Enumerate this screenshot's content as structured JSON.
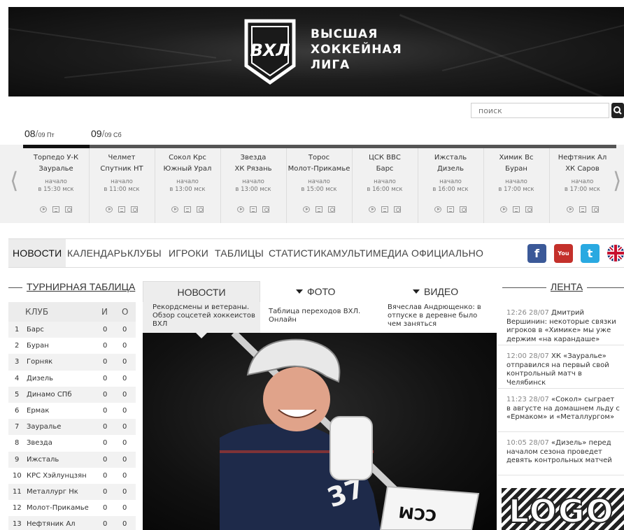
{
  "header": {
    "logo_mark": "ВХЛ",
    "logo_line1": "ВЫСШАЯ",
    "logo_line2": "ХОККЕЙНАЯ",
    "logo_line3": "ЛИГА"
  },
  "search": {
    "placeholder": "поиск"
  },
  "dates": [
    {
      "day": "08",
      "sep": "/",
      "label": "09 Пт"
    },
    {
      "day": "09",
      "sep": "/",
      "label": "09 Сб"
    }
  ],
  "games": [
    {
      "home": "Торпедо У-К",
      "away": "Зауралье",
      "start_label": "начало",
      "time": "в 15:30 мск"
    },
    {
      "home": "Челмет",
      "away": "Спутник НТ",
      "start_label": "начало",
      "time": "в 11:00 мск"
    },
    {
      "home": "Сокол Крс",
      "away": "Южный Урал",
      "start_label": "начало",
      "time": "в 13:00 мск"
    },
    {
      "home": "Звезда",
      "away": "ХК Рязань",
      "start_label": "начало",
      "time": "в 13:00 мск"
    },
    {
      "home": "Торос",
      "away": "Молот-Прикамье",
      "start_label": "начало",
      "time": "в 15:00 мск"
    },
    {
      "home": "ЦСК ВВС",
      "away": "Барс",
      "start_label": "начало",
      "time": "в 16:00 мск"
    },
    {
      "home": "Ижсталь",
      "away": "Дизель",
      "start_label": "начало",
      "time": "в 16:00 мск"
    },
    {
      "home": "Химик Вс",
      "away": "Буран",
      "start_label": "начало",
      "time": "в 17:00 мск"
    },
    {
      "home": "Нефтяник Ал",
      "away": "ХК Саров",
      "start_label": "начало",
      "time": "в 17:00 мск"
    }
  ],
  "nav": {
    "items": [
      "НОВОСТИ",
      "КАЛЕНДАРЬ",
      "КЛУБЫ",
      "ИГРОКИ",
      "ТАБЛИЦЫ",
      "СТАТИСТИКА",
      "МУЛЬТИМЕДИА",
      "ОФИЦИАЛЬНО"
    ],
    "social": {
      "facebook": "f",
      "youtube": "You",
      "twitter": "t"
    }
  },
  "standings": {
    "title": "ТУРНИРНАЯ ТАБЛИЦА",
    "col_club": "КЛУБ",
    "col_games": "И",
    "col_points": "О",
    "rows": [
      {
        "pos": "1",
        "club": "Барс",
        "games": "0",
        "points": "0"
      },
      {
        "pos": "2",
        "club": "Буран",
        "games": "0",
        "points": "0"
      },
      {
        "pos": "3",
        "club": "Горняк",
        "games": "0",
        "points": "0"
      },
      {
        "pos": "4",
        "club": "Дизель",
        "games": "0",
        "points": "0"
      },
      {
        "pos": "5",
        "club": "Динамо СПб",
        "games": "0",
        "points": "0"
      },
      {
        "pos": "6",
        "club": "Ермак",
        "games": "0",
        "points": "0"
      },
      {
        "pos": "7",
        "club": "Зауралье",
        "games": "0",
        "points": "0"
      },
      {
        "pos": "8",
        "club": "Звезда",
        "games": "0",
        "points": "0"
      },
      {
        "pos": "9",
        "club": "Ижсталь",
        "games": "0",
        "points": "0"
      },
      {
        "pos": "10",
        "club": "КРС Хэйлунцзян",
        "games": "0",
        "points": "0"
      },
      {
        "pos": "11",
        "club": "Металлург Нк",
        "games": "0",
        "points": "0"
      },
      {
        "pos": "12",
        "club": "Молот-Прикамье",
        "games": "0",
        "points": "0"
      },
      {
        "pos": "13",
        "club": "Нефтяник Ал",
        "games": "0",
        "points": "0"
      }
    ]
  },
  "media_tabs": {
    "news": "НОВОСТИ",
    "photo": "ФОТО",
    "video": "ВИДЕО"
  },
  "headlines": [
    "Рекордсмены и ветераны. Обзор соцсетей хоккеистов ВХЛ",
    "Таблица переходов ВХЛ. Онлайн",
    "Вячеслав Андрющенко: в отпуске в деревне было чем заняться"
  ],
  "photo": {
    "jersey_number": "37",
    "equipment_brand": "CCM"
  },
  "lenta": {
    "title": "ЛЕНТА",
    "items": [
      {
        "time": "12:26 28/07",
        "text": "Дмитрий Вершинин: некоторые связки игроков в «Химике» мы уже держим «на карандаше»"
      },
      {
        "time": "12:00 28/07",
        "text": "ХК «Зауралье» отправился на первый свой контрольный матч в Челябинск"
      },
      {
        "time": "11:23 28/07",
        "text": "«Сокол» сыграет в августе на домашнем льду с «Ермаком» и «Металлургом»"
      },
      {
        "time": "10:05 28/07",
        "text": "«Дизель» перед началом сезона проведет девять контрольных матчей"
      }
    ]
  },
  "ad": {
    "text": "LOGO"
  }
}
